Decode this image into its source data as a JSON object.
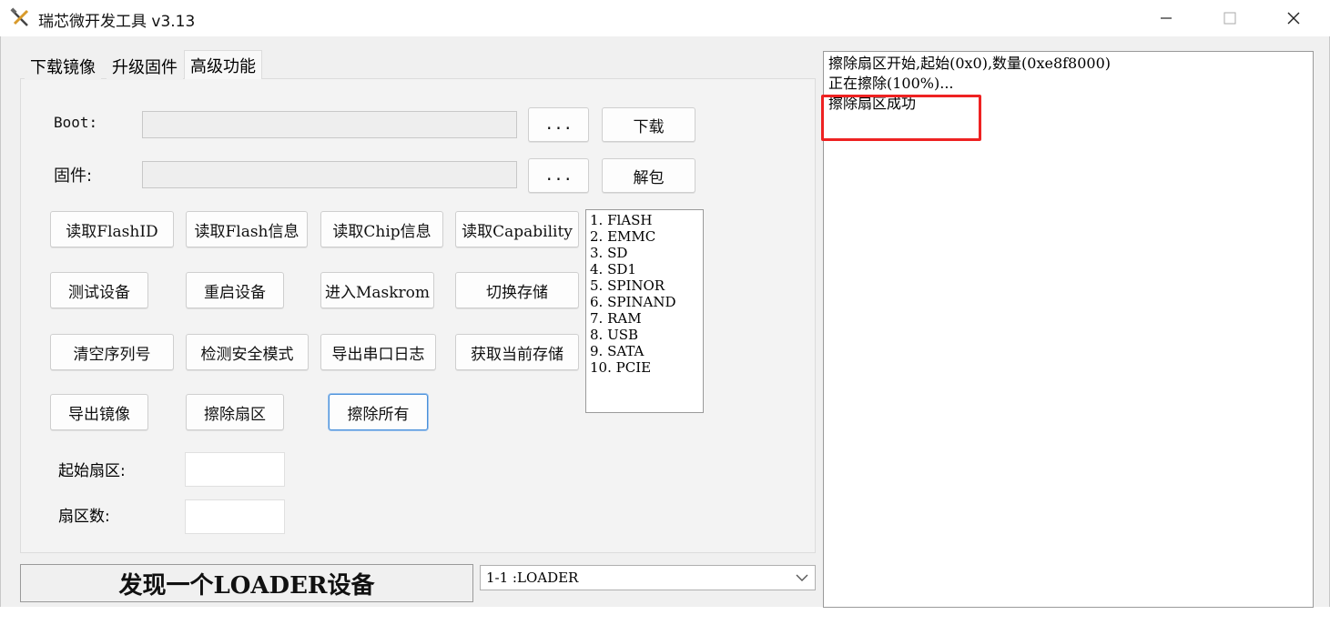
{
  "window": {
    "title": "瑞芯微开发工具 v3.13"
  },
  "tabs": [
    {
      "label": "下载镜像"
    },
    {
      "label": "升级固件"
    },
    {
      "label": "高级功能"
    }
  ],
  "boot": {
    "label": "Boot:",
    "value": "",
    "browse": "...",
    "action": "下载"
  },
  "firmware": {
    "label": "固件:",
    "value": "",
    "browse": "...",
    "action": "解包"
  },
  "buttons": {
    "read_flash_id": "读取FlashID",
    "read_flash_info": "读取Flash信息",
    "read_chip_info": "读取Chip信息",
    "read_capability": "读取Capability",
    "test_device": "测试设备",
    "reboot_device": "重启设备",
    "enter_maskrom": "进入Maskrom",
    "switch_storage": "切换存储",
    "clear_serial": "清空序列号",
    "check_secure_mode": "检测安全模式",
    "export_serial_log": "导出串口日志",
    "get_current_storage": "获取当前存储",
    "export_image": "导出镜像",
    "erase_sector": "擦除扇区",
    "erase_all": "擦除所有"
  },
  "storage_list": [
    "1.  FlASH",
    "2.  EMMC",
    "3.  SD",
    "4.  SD1",
    "5.  SPINOR",
    "6.  SPINAND",
    "7.  RAM",
    "8.  USB",
    "9.  SATA",
    "10.  PCIE"
  ],
  "start_sector": {
    "label": "起始扇区:",
    "value": ""
  },
  "sector_count": {
    "label": "扇区数:",
    "value": ""
  },
  "status": {
    "text": "发现一个LOADER设备"
  },
  "device_combo": {
    "value": "1-1  :LOADER"
  },
  "log": [
    "擦除扇区开始,起始(0x0),数量(0xe8f8000)",
    "正在擦除(100%)...",
    "擦除扇区成功"
  ],
  "colors": {
    "highlight": "#e22222",
    "focus": "#4a90d9"
  }
}
